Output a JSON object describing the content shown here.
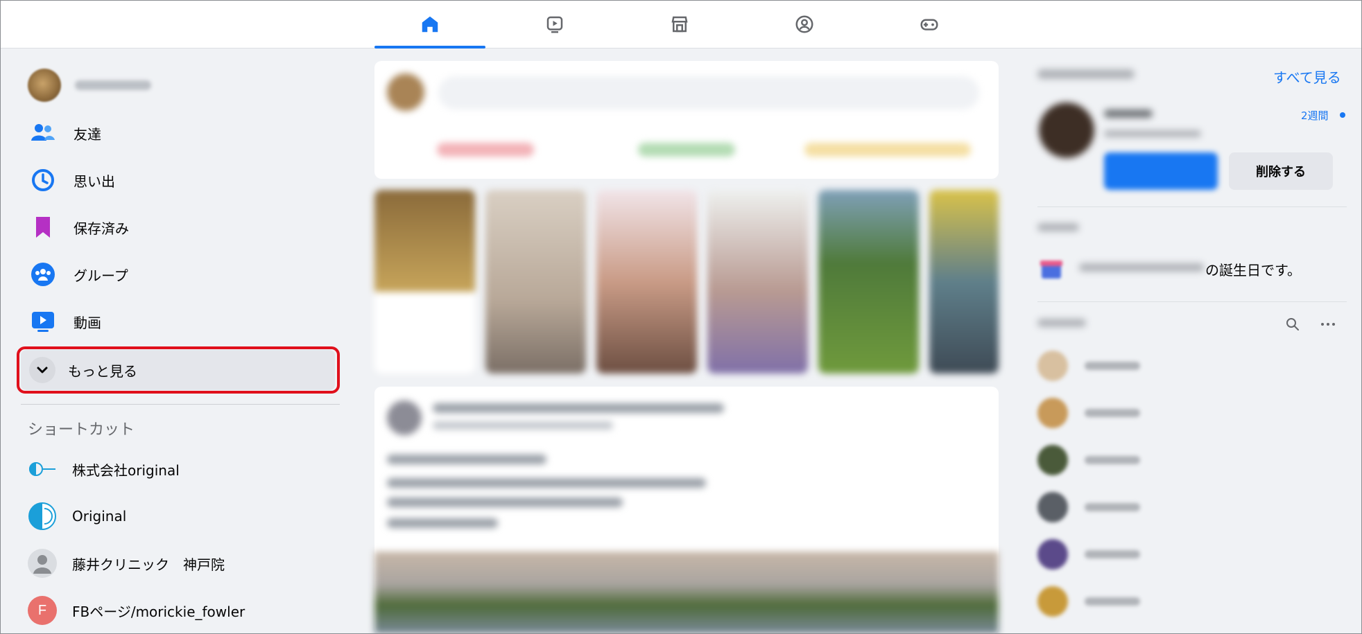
{
  "sidebar": {
    "items": [
      {
        "label": "友達",
        "icon": "friends-icon"
      },
      {
        "label": "思い出",
        "icon": "memories-icon"
      },
      {
        "label": "保存済み",
        "icon": "saved-icon"
      },
      {
        "label": "グループ",
        "icon": "groups-icon"
      },
      {
        "label": "動画",
        "icon": "video-icon"
      }
    ],
    "see_more": {
      "label": "もっと見る",
      "icon": "chevron-down-icon"
    },
    "shortcuts_title": "ショートカット",
    "shortcuts": [
      {
        "label": "株式会社original",
        "icon": "original-logo-icon"
      },
      {
        "label": "Original",
        "icon": "original-circle-icon"
      },
      {
        "label": "藤井クリニック　神戸院",
        "icon": "default-profile-icon"
      },
      {
        "label": "FBページ/morickie_fowler",
        "icon": "page-letter-icon",
        "letter": "F"
      }
    ]
  },
  "right": {
    "see_all": "すべて見る",
    "request_time": "2週間",
    "delete_label": "削除する",
    "birthday_text": "の誕生日です。"
  },
  "colors": {
    "accent": "#1877f2",
    "highlight_border": "#e0101c",
    "friends_icon": "#1877f2",
    "saved_icon": "#b530c4",
    "page_avatar": "#e9716d"
  }
}
